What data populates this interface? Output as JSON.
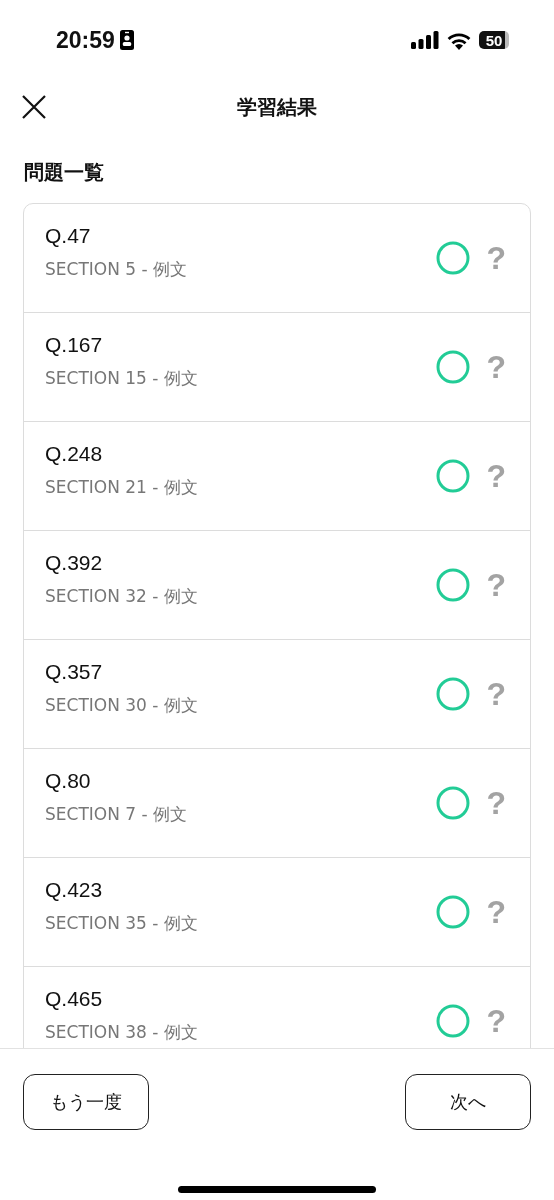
{
  "status_bar": {
    "time": "20:59",
    "battery": "50"
  },
  "header": {
    "title": "学習結果"
  },
  "section_title": "問題一覧",
  "questions": [
    {
      "number": "Q.47",
      "section": "SECTION 5 - 例文",
      "correct": true,
      "mark": "?"
    },
    {
      "number": "Q.167",
      "section": "SECTION 15 - 例文",
      "correct": true,
      "mark": "?"
    },
    {
      "number": "Q.248",
      "section": "SECTION 21 - 例文",
      "correct": true,
      "mark": "?"
    },
    {
      "number": "Q.392",
      "section": "SECTION 32 - 例文",
      "correct": true,
      "mark": "?"
    },
    {
      "number": "Q.357",
      "section": "SECTION 30 - 例文",
      "correct": true,
      "mark": "?"
    },
    {
      "number": "Q.80",
      "section": "SECTION 7 - 例文",
      "correct": true,
      "mark": "?"
    },
    {
      "number": "Q.423",
      "section": "SECTION 35 - 例文",
      "correct": true,
      "mark": "?"
    },
    {
      "number": "Q.465",
      "section": "SECTION 38 - 例文",
      "correct": true,
      "mark": "?"
    }
  ],
  "buttons": [
    {
      "label": "もう一度"
    },
    {
      "label": "次へ"
    }
  ]
}
